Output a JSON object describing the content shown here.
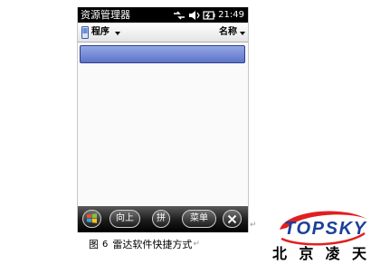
{
  "statusbar": {
    "app_title": "资源管理器",
    "time": "21:49",
    "icons": [
      "signal-icon",
      "speaker-icon",
      "battery-icon"
    ]
  },
  "toolbar": {
    "folder_label": "程序",
    "sort_label": "名称",
    "folder_icon": "pda-device-icon",
    "caret_icon": "caret-down-icon"
  },
  "file_list": {
    "rows": [
      {
        "selected": true,
        "label": ""
      }
    ]
  },
  "softbar": {
    "up_label": "向上",
    "spell_label": "拼",
    "menu_label": "菜单",
    "start_icon": "windows-start-icon",
    "close_icon": "close-icon"
  },
  "caption": {
    "prefix": "图",
    "number": "6",
    "text": "雷达软件快捷方式",
    "tail": "↵"
  },
  "return_mark": "↵",
  "logo": {
    "brand": "TOPSKY",
    "chinese_chars": [
      "北",
      "京",
      "凌",
      "天"
    ],
    "brand_color": "#1b3f99",
    "swoosh_color": "#e02020"
  }
}
